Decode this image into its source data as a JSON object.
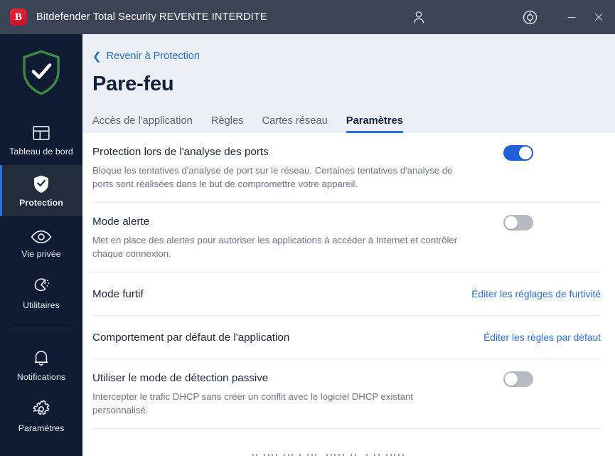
{
  "titlebar": {
    "logo_letter": "B",
    "title": "Bitdefender Total Security REVENTE INTERDITE",
    "account_icon": "person-icon",
    "help_icon": "lifebuoy-icon",
    "minimize_icon": "minimize-icon",
    "close_icon": "close-icon"
  },
  "sidebar": {
    "brand_icon": "shield-check-icon",
    "items": [
      {
        "label": "Tableau de bord",
        "icon": "dashboard-icon",
        "active": false
      },
      {
        "label": "Protection",
        "icon": "shield-check-filled-icon",
        "active": true
      },
      {
        "label": "Vie privée",
        "icon": "eye-icon",
        "active": false
      },
      {
        "label": "Utilitaires",
        "icon": "tools-icon",
        "active": false
      },
      {
        "label": "Notifications",
        "icon": "bell-icon",
        "active": false
      },
      {
        "label": "Paramètres",
        "icon": "gear-icon",
        "active": false
      }
    ]
  },
  "header": {
    "back_label": "Revenir à Protection",
    "back_icon": "chevron-left-icon",
    "page_title": "Pare-feu",
    "tabs": [
      {
        "label": "Accès de l'application",
        "active": false
      },
      {
        "label": "Règles",
        "active": false
      },
      {
        "label": "Cartes réseau",
        "active": false
      },
      {
        "label": "Paramètres",
        "active": true
      }
    ]
  },
  "settings": {
    "rows": [
      {
        "title": "Protection lors de l'analyse des ports",
        "desc": "Bloque les tentatives d'analyse de port sur le réseau. Certaines tentatives d'analyse de ports sont réalisées dans le but de compromettre votre appareil.",
        "control": "toggle",
        "state": "on"
      },
      {
        "title": "Mode alerte",
        "desc": "Met en place des alertes pour autoriser les applications à accéder à Internet et contrôler chaque connexion.",
        "control": "toggle",
        "state": "off"
      },
      {
        "title": "Mode furtif",
        "desc": "",
        "control": "link",
        "link_label": "Éditer les réglages de furtivité"
      },
      {
        "title": "Comportement par défaut de l'application",
        "desc": "",
        "control": "link",
        "link_label": "Éditer les règles par défaut"
      },
      {
        "title": "Utiliser le mode de détection passive",
        "desc": "Intercepter le trafic DHCP sans créer un conflit avec le logiciel DHCP existant personnalisé.",
        "control": "toggle",
        "state": "off"
      }
    ]
  },
  "colors": {
    "titlebar_bg": "#3c4555",
    "sidebar_bg": "#0e1b33",
    "sidebar_active_bg": "#232c3d",
    "accent_blue": "#2a72dd",
    "link_blue": "#2a6fc4",
    "toggle_on": "#1f62d8",
    "toggle_off": "#b6bac1",
    "header_bg": "#edeff7",
    "brand_red": "#c3102a",
    "shield_green": "#3d8b40"
  }
}
